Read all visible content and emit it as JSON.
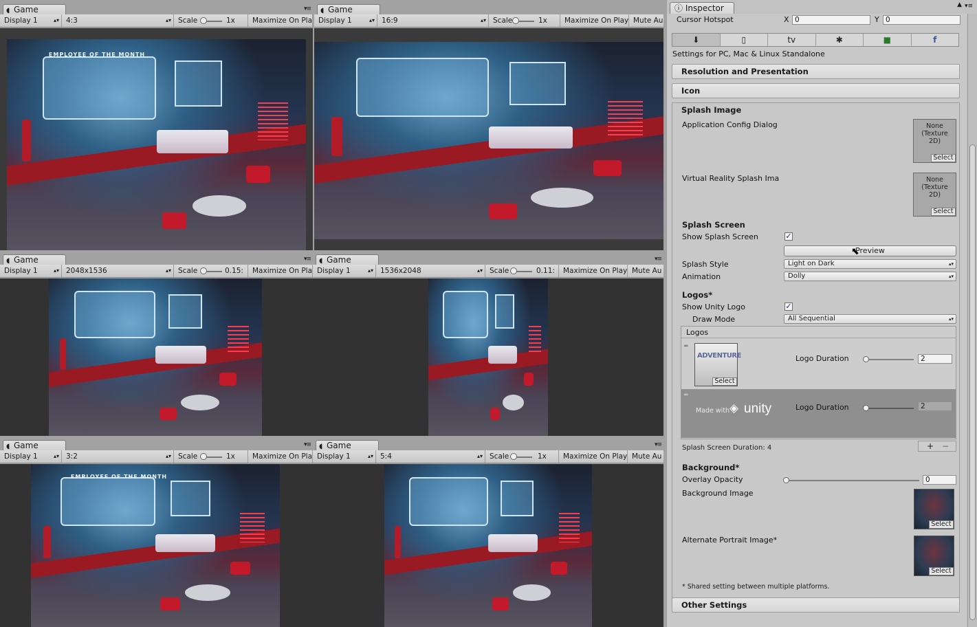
{
  "game_panels": [
    {
      "tab": "Game",
      "display": "Display 1",
      "aspect": "4:3",
      "scale_label": "Scale",
      "scale_value": "1x",
      "maximize": "Maximize On Play",
      "mute": ""
    },
    {
      "tab": "Game",
      "display": "Display 1",
      "aspect": "16:9",
      "scale_label": "Scale",
      "scale_value": "1x",
      "maximize": "Maximize On Play",
      "mute": "Mute Au"
    },
    {
      "tab": "Game",
      "display": "Display 1",
      "aspect": "2048x1536",
      "scale_label": "Scale",
      "scale_value": "0.15:",
      "maximize": "Maximize On Play",
      "mute": ""
    },
    {
      "tab": "Game",
      "display": "Display 1",
      "aspect": "1536x2048",
      "scale_label": "Scale",
      "scale_value": "0.11:",
      "maximize": "Maximize On Play",
      "mute": "Mute Au"
    },
    {
      "tab": "Game",
      "display": "Display 1",
      "aspect": "3:2",
      "scale_label": "Scale",
      "scale_value": "1x",
      "maximize": "Maximize On Play",
      "mute": ""
    },
    {
      "tab": "Game",
      "display": "Display 1",
      "aspect": "5:4",
      "scale_label": "Scale",
      "scale_value": "1x",
      "maximize": "Maximize On Play",
      "mute": "Mute Au"
    }
  ],
  "scene": {
    "sign": "EMPLOYEE OF THE MONTH"
  },
  "inspector": {
    "tab": "Inspector",
    "cursor_hotspot": {
      "label": "Cursor Hotspot",
      "x_label": "X",
      "x_value": "0",
      "y_label": "Y",
      "y_value": "0"
    },
    "platforms": [
      {
        "icon": "download-icon",
        "glyph": "⬇"
      },
      {
        "icon": "phone-icon",
        "glyph": "▯"
      },
      {
        "icon": "apple-tv-icon",
        "glyph": "tv"
      },
      {
        "icon": "android-icon",
        "glyph": "✱"
      },
      {
        "icon": "xbox-icon",
        "glyph": "■"
      },
      {
        "icon": "facebook-icon",
        "glyph": "f"
      }
    ],
    "settings_for": "Settings for PC, Mac & Linux Standalone",
    "sections": {
      "resolution": "Resolution and Presentation",
      "icon": "Icon",
      "splash_image": "Splash Image",
      "other": "Other Settings"
    },
    "app_config_dialog": "Application Config Dialog",
    "vr_splash": "Virtual Reality Splash Ima",
    "texture_none": "None\n(Texture\n2D)",
    "select": "Select",
    "splash_screen_header": "Splash Screen",
    "show_splash": "Show Splash Screen",
    "preview": "Preview",
    "splash_style_label": "Splash Style",
    "splash_style_value": "Light on Dark",
    "animation_label": "Animation",
    "animation_value": "Dolly",
    "logos_header": "Logos*",
    "show_unity_logo": "Show Unity Logo",
    "draw_mode_label": "Draw Mode",
    "draw_mode_value": "All Sequential",
    "logos_list_title": "Logos",
    "logo1": {
      "duration_label": "Logo Duration",
      "duration_value": "2",
      "thumb_text": "ADVENTURE"
    },
    "logo2": {
      "duration_label": "Logo Duration",
      "duration_value": "2",
      "made_with": "Made with",
      "unity": "unity"
    },
    "splash_duration": "Splash Screen Duration: 4",
    "add": "+",
    "remove": "−",
    "background_header": "Background*",
    "overlay_opacity_label": "Overlay Opacity",
    "overlay_opacity_value": "0",
    "background_image_label": "Background Image",
    "alternate_portrait_label": "Alternate Portrait Image*",
    "shared_note": "* Shared setting between multiple platforms."
  }
}
